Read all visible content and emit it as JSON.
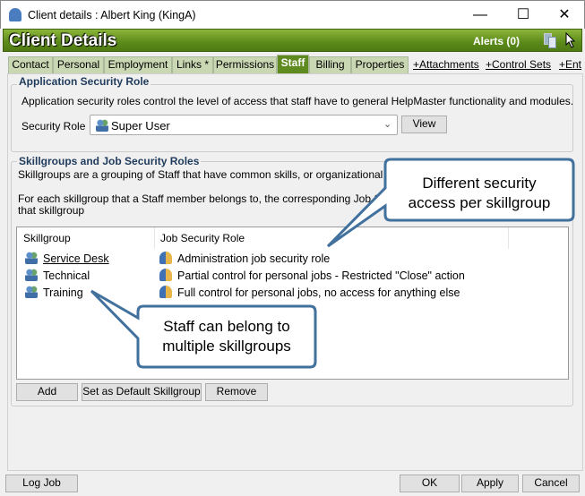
{
  "window": {
    "title": "Client details : Albert King  (KingA)",
    "minimize": "—",
    "maximize": "☐",
    "close": "✕"
  },
  "header": {
    "title": "Client Details",
    "alerts": "Alerts (0)"
  },
  "tabs": [
    {
      "label": "Contact"
    },
    {
      "label": "Personal"
    },
    {
      "label": "Employment"
    },
    {
      "label": "Links *"
    },
    {
      "label": "Permissions"
    },
    {
      "label": "Staff",
      "selected": true
    },
    {
      "label": "Billing"
    },
    {
      "label": "Properties"
    }
  ],
  "links": [
    "+Attachments",
    "+Control Sets",
    "+Ent"
  ],
  "app_security": {
    "legend": "Application Security Role",
    "description": "Application security roles control the level of access that staff have to general HelpMaster functionality and modules.",
    "role_label": "Security Role",
    "role_value": "Super User",
    "view_button": "View"
  },
  "skillgroups": {
    "legend": "Skillgroups and Job Security Roles",
    "desc1": "Skillgroups are a grouping of Staff that have common skills, or organizational structure.",
    "desc2": "For each skillgroup that a Staff member belongs to, the corresponding Job Security Rol",
    "desc3": "that skillgroup",
    "columns": [
      "Skillgroup",
      "Job Security Role"
    ],
    "rows": [
      {
        "skillgroup": "Service Desk",
        "role": "Administration job security role",
        "default": true
      },
      {
        "skillgroup": "Technical",
        "role": "Partial control for personal jobs - Restricted \"Close\" action"
      },
      {
        "skillgroup": "Training",
        "role": "Full control for personal jobs, no access for anything else"
      }
    ],
    "buttons": {
      "add": "Add",
      "set_default": "Set as Default Skillgroup",
      "remove": "Remove"
    }
  },
  "callouts": {
    "top_line1": "Different security",
    "top_line2": "access per skillgroup",
    "bottom_line1": "Staff can belong to",
    "bottom_line2": "multiple skillgroups"
  },
  "footer": {
    "log_job": "Log Job",
    "ok": "OK",
    "apply": "Apply",
    "cancel": "Cancel"
  },
  "colors": {
    "header_green": "#5c8a1a",
    "callout_border": "#41719c"
  }
}
